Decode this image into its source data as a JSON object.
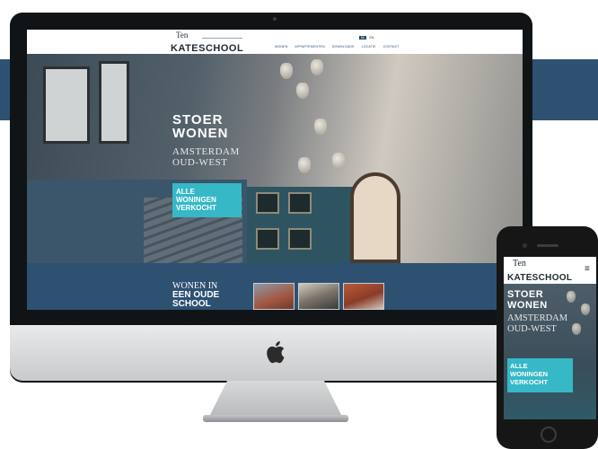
{
  "site": {
    "logo_top": "Ten",
    "logo_main": "KATESCHOOL",
    "nav": [
      "WONEN",
      "APPARTEMENTEN",
      "DOWNLOADS",
      "LOCATIE",
      "CONTACT"
    ],
    "lang": [
      "NL",
      "EN"
    ]
  },
  "hero": {
    "title_line1": "STOER",
    "title_line2": "WONEN",
    "sub_line1": "AMSTERDAM",
    "sub_line2": "OUD-WEST",
    "cta_line1": "ALLE",
    "cta_line2": "WONINGEN",
    "cta_line3": "VERKOCHT"
  },
  "lower": {
    "line1": "WONEN IN",
    "line2": "EEN OUDE",
    "line3": "SCHOOL"
  },
  "mobile": {
    "logo_top": "Ten",
    "logo_main": "KATESCHOOL",
    "menu_icon": "≡",
    "title_line1": "STOER",
    "title_line2": "WONEN",
    "sub_line1": "AMSTERDAM",
    "sub_line2": "OUD-WEST",
    "cta_line1": "ALLE",
    "cta_line2": "WONINGEN",
    "cta_line3": "VERKOCHT"
  },
  "colors": {
    "brand_blue": "#2e5172",
    "accent_teal": "#36b8c6"
  }
}
